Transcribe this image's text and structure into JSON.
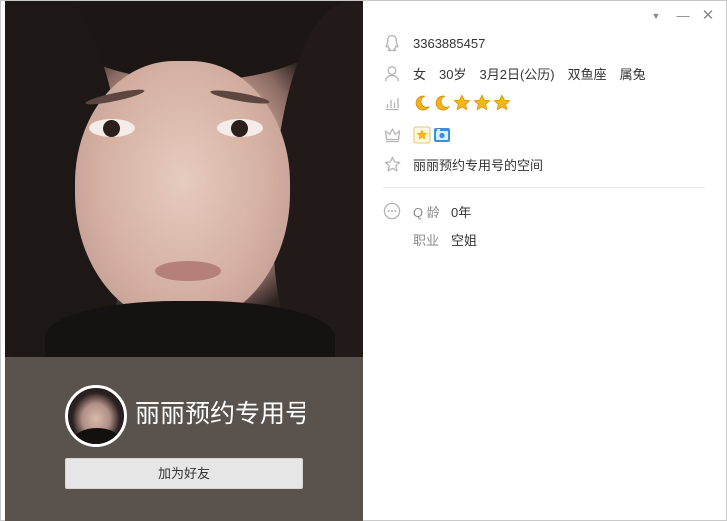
{
  "window": {
    "controls": {
      "menu": "▼",
      "minimize": "—",
      "close": "✕"
    }
  },
  "profile": {
    "nickname": "丽丽预约专用号",
    "add_friend_label": "加为好友"
  },
  "info": {
    "qq_number": "3363885457",
    "gender": "女",
    "age": "30岁",
    "birthday": "3月2日(公历)",
    "zodiac": "双鱼座",
    "chinese_zodiac": "属兔",
    "level_icons": [
      "moon",
      "moon",
      "star",
      "star",
      "star"
    ],
    "vip_icons": [
      "star-badge-icon",
      "camera-badge-icon"
    ],
    "space_link": "丽丽预约专用号的空间",
    "q_age_label": "Q 龄",
    "q_age_value": "0年",
    "job_label": "职业",
    "job_value": "空姐"
  },
  "colors": {
    "panel_bg": "#5a524d",
    "button_bg": "#e6e6e6",
    "icon_gray": "#b5b5b5",
    "star_gold": "#f5b61b",
    "moon_gold": "#f3b21b"
  }
}
